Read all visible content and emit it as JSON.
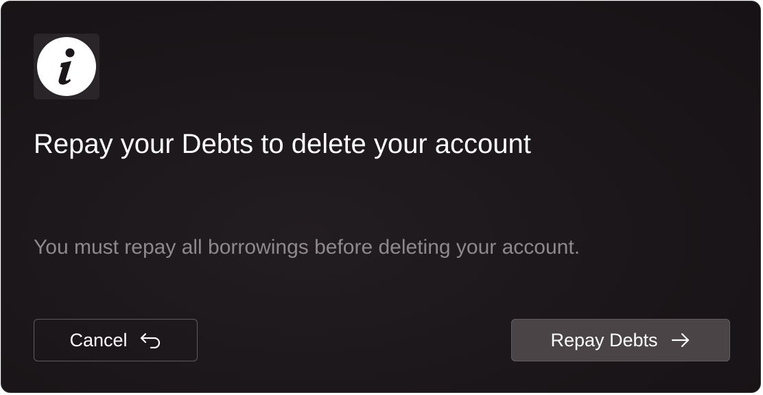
{
  "dialog": {
    "icon": "info-icon",
    "title": "Repay your Debts to delete your account",
    "message": "You must repay all borrowings before deleting your account."
  },
  "buttons": {
    "cancel": {
      "label": "Cancel",
      "icon": "undo-arrow-icon"
    },
    "repay": {
      "label": "Repay Debts",
      "icon": "arrow-right-icon"
    }
  },
  "colors": {
    "background": "#1a1619",
    "title": "#ffffff",
    "message": "#8f898d",
    "primary_button": "#4a4447",
    "border": "#615b5f"
  }
}
